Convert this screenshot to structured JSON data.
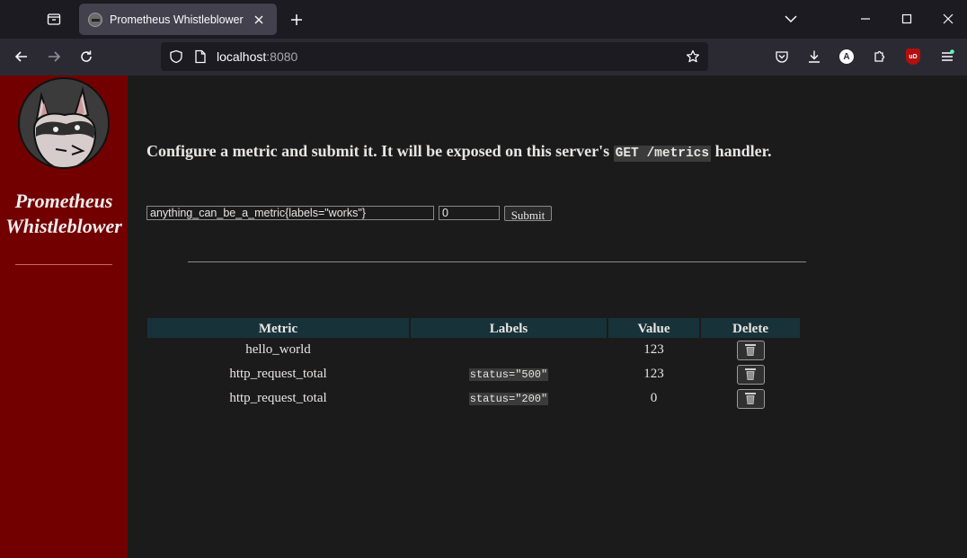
{
  "browser": {
    "tab_title": "Prometheus Whistleblower",
    "url_host": "localhost",
    "url_port": ":8080",
    "profile_initial": "A",
    "ublock_label": "uD"
  },
  "sidebar": {
    "brand_line1": "Prometheus",
    "brand_line2": "Whistleblower"
  },
  "main": {
    "heading_before": "Configure a metric and submit it. It will be exposed on this server's ",
    "heading_code": "GET /metrics",
    "heading_after": " handler.",
    "form": {
      "metric_value": "anything_can_be_a_metric{labels=\"works\"}",
      "number_value": "0",
      "submit_label": "Submit"
    }
  },
  "table": {
    "headers": [
      "Metric",
      "Labels",
      "Value",
      "Delete"
    ],
    "rows": [
      {
        "metric": "hello_world",
        "labels": "",
        "value": "123"
      },
      {
        "metric": "http_request_total",
        "labels": "status=\"500\"",
        "value": "123"
      },
      {
        "metric": "http_request_total",
        "labels": "status=\"200\"",
        "value": "0"
      }
    ]
  },
  "colors": {
    "sidebar_bg": "#720000",
    "header_bg": "#18323a",
    "page_bg": "#1c1b1c"
  }
}
